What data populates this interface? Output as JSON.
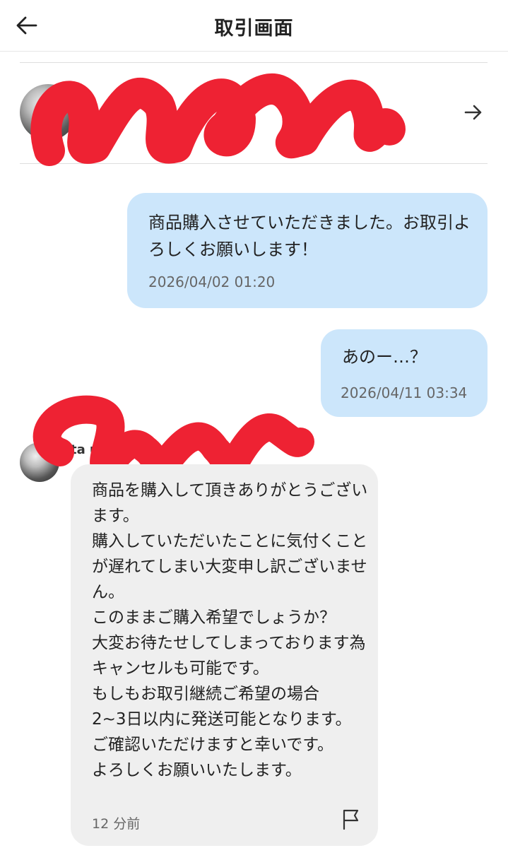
{
  "header": {
    "title": "取引画面",
    "back_icon": "back-arrow-icon"
  },
  "partner_card": {
    "arrow_icon": "arrow-right-icon"
  },
  "messages": [
    {
      "direction": "outgoing",
      "text": "商品購入させていただきました。お取引よろしくお願いします！",
      "time": "2026/04/02 01:20"
    },
    {
      "direction": "outgoing",
      "text": "あのー…？",
      "time": "2026/04/11 03:34"
    },
    {
      "direction": "incoming",
      "sender_visible": "ta    ub     入       読！",
      "text": "商品を購入して頂きありがとうございます。\n購入していただいたことに気付くことが遅れてしまい大変申し訳ございません。\nこのままご購入希望でしょうか？\n大変お待たせしてしまっております為キャンセルも可能です。\nもしもお取引継続ご希望の場合\n2~3日以内に発送可能となります。\nご確認いただけますと幸いです。\nよろしくお願いいたします。",
      "time": "12 分前",
      "flag_icon": "flag-icon"
    }
  ],
  "colors": {
    "outgoing_bubble": "#cce6fb",
    "incoming_bubble": "#efefef",
    "redaction": "#ee2233"
  }
}
